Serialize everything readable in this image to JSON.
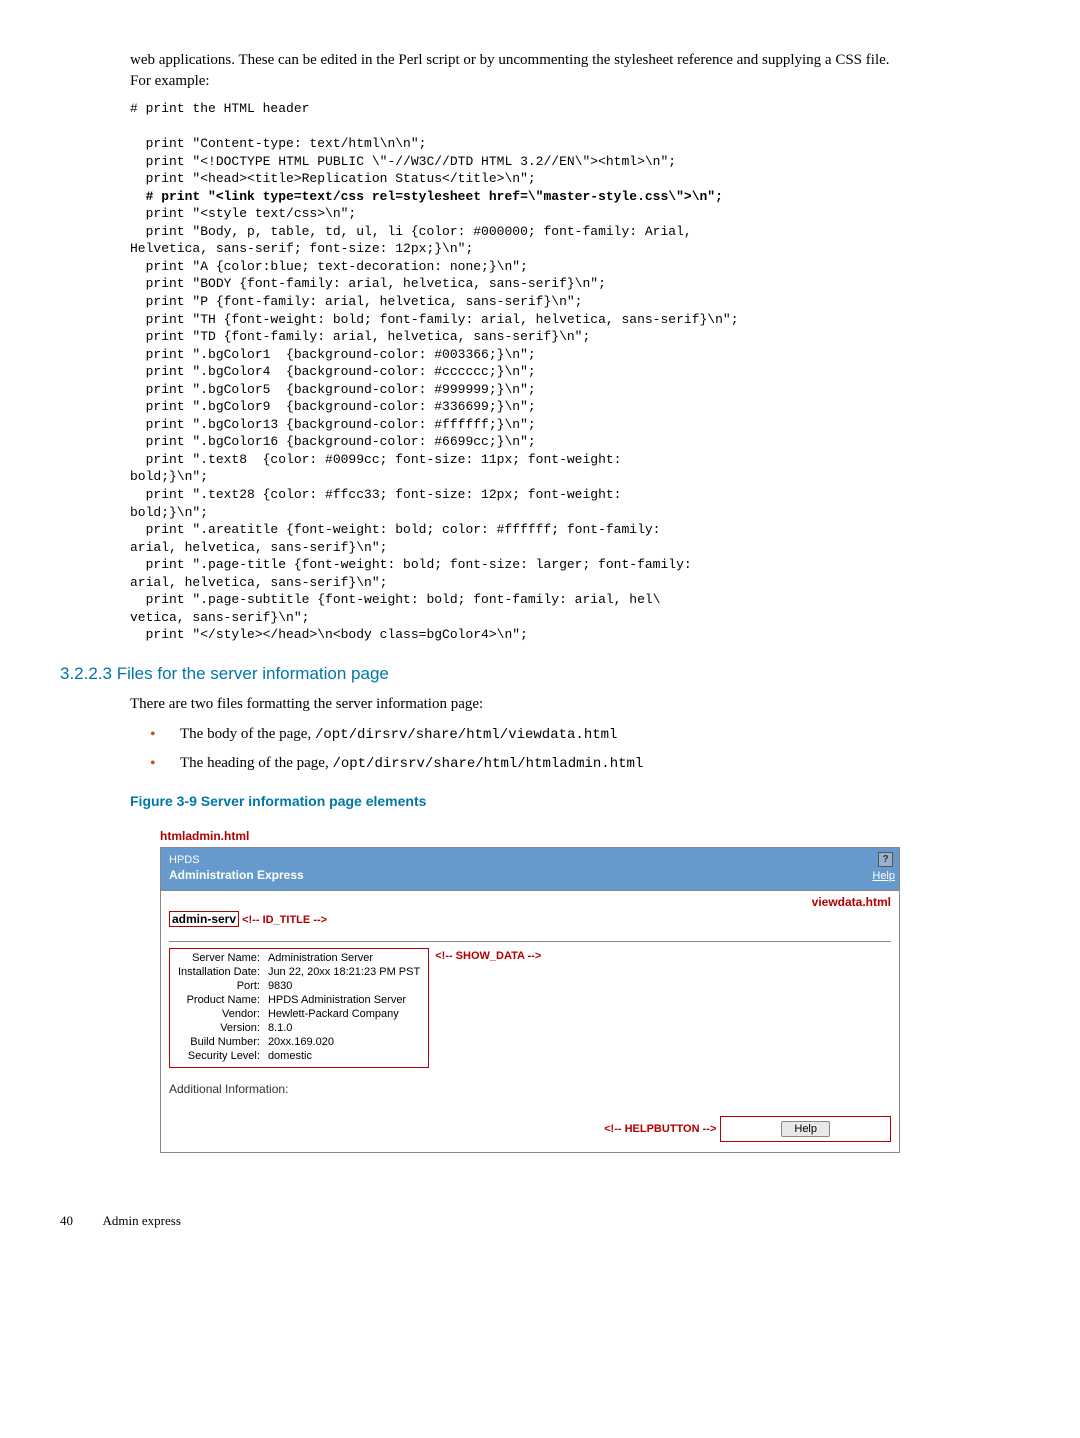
{
  "intro": "web applications. These can be edited in the Perl script or by uncommenting the stylesheet reference and supplying a CSS file. For example:",
  "code": {
    "l01": "# print the HTML header",
    "l02": "",
    "l03": "  print \"Content-type: text/html\\n\\n\";",
    "l04": "  print \"<!DOCTYPE HTML PUBLIC \\\"-//W3C//DTD HTML 3.2//EN\\\"><html>\\n\";",
    "l05": "  print \"<head><title>Replication Status</title>\\n\";",
    "l06": "  # print \"<link type=text/css rel=stylesheet href=\\\"master-style.css\\\">\\n\";",
    "l07": "  print \"<style text/css>\\n\";",
    "l08": "  print \"Body, p, table, td, ul, li {color: #000000; font-family: Arial,",
    "l09": "Helvetica, sans-serif; font-size: 12px;}\\n\";",
    "l10": "  print \"A {color:blue; text-decoration: none;}\\n\";",
    "l11": "  print \"BODY {font-family: arial, helvetica, sans-serif}\\n\";",
    "l12": "  print \"P {font-family: arial, helvetica, sans-serif}\\n\";",
    "l13": "  print \"TH {font-weight: bold; font-family: arial, helvetica, sans-serif}\\n\";",
    "l14": "  print \"TD {font-family: arial, helvetica, sans-serif}\\n\";",
    "l15": "  print \".bgColor1  {background-color: #003366;}\\n\";",
    "l16": "  print \".bgColor4  {background-color: #cccccc;}\\n\";",
    "l17": "  print \".bgColor5  {background-color: #999999;}\\n\";",
    "l18": "  print \".bgColor9  {background-color: #336699;}\\n\";",
    "l19": "  print \".bgColor13 {background-color: #ffffff;}\\n\";",
    "l20": "  print \".bgColor16 {background-color: #6699cc;}\\n\";",
    "l21": "  print \".text8  {color: #0099cc; font-size: 11px; font-weight:",
    "l22": "bold;}\\n\";",
    "l23": "  print \".text28 {color: #ffcc33; font-size: 12px; font-weight:",
    "l24": "bold;}\\n\";",
    "l25": "  print \".areatitle {font-weight: bold; color: #ffffff; font-family:",
    "l26": "arial, helvetica, sans-serif}\\n\";",
    "l27": "  print \".page-title {font-weight: bold; font-size: larger; font-family:",
    "l28": "arial, helvetica, sans-serif}\\n\";",
    "l29": "  print \".page-subtitle {font-weight: bold; font-family: arial, hel\\",
    "l30": "vetica, sans-serif}\\n\";",
    "l31": "  print \"</style></head>\\n<body class=bgColor4>\\n\";"
  },
  "section": {
    "number": "3.2.2.3",
    "title": "Files for the server information page"
  },
  "body1": "There are two files formatting the server information page:",
  "bullets": {
    "b1_text": "The body of the page, ",
    "b1_path": "/opt/dirsrv/share/html/viewdata.html",
    "b2_text": "The heading of the page, ",
    "b2_path": "/opt/dirsrv/share/html/htmladmin.html"
  },
  "figure_caption": "Figure 3-9 Server information page elements",
  "figure": {
    "top_label": "htmladmin.html",
    "header_line1": "HPDS",
    "header_line2": "Administration Express",
    "help_icon": "?",
    "help_link": "Help",
    "viewdata_label": "viewdata.html",
    "id_server": "admin-serv",
    "id_comment": "<!-- ID_TITLE -->",
    "showdata_comment": "<!-- SHOW_DATA -->",
    "rows": [
      {
        "label": "Server Name:",
        "value": "Administration Server"
      },
      {
        "label": "Installation Date:",
        "value": "Jun 22, 20xx 18:21:23 PM PST"
      },
      {
        "label": "Port:",
        "value": "9830"
      },
      {
        "label": "Product Name:",
        "value": "HPDS Administration Server"
      },
      {
        "label": "Vendor:",
        "value": "Hewlett-Packard Company"
      },
      {
        "label": "Version:",
        "value": "8.1.0"
      },
      {
        "label": "Build Number:",
        "value": "20xx.169.020"
      },
      {
        "label": "Security Level:",
        "value": "domestic"
      }
    ],
    "additional": "Additional Information:",
    "helpbutton_comment": "<!-- HELPBUTTON -->",
    "help_button": "Help"
  },
  "footer": {
    "page_number": "40",
    "section": "Admin express"
  }
}
